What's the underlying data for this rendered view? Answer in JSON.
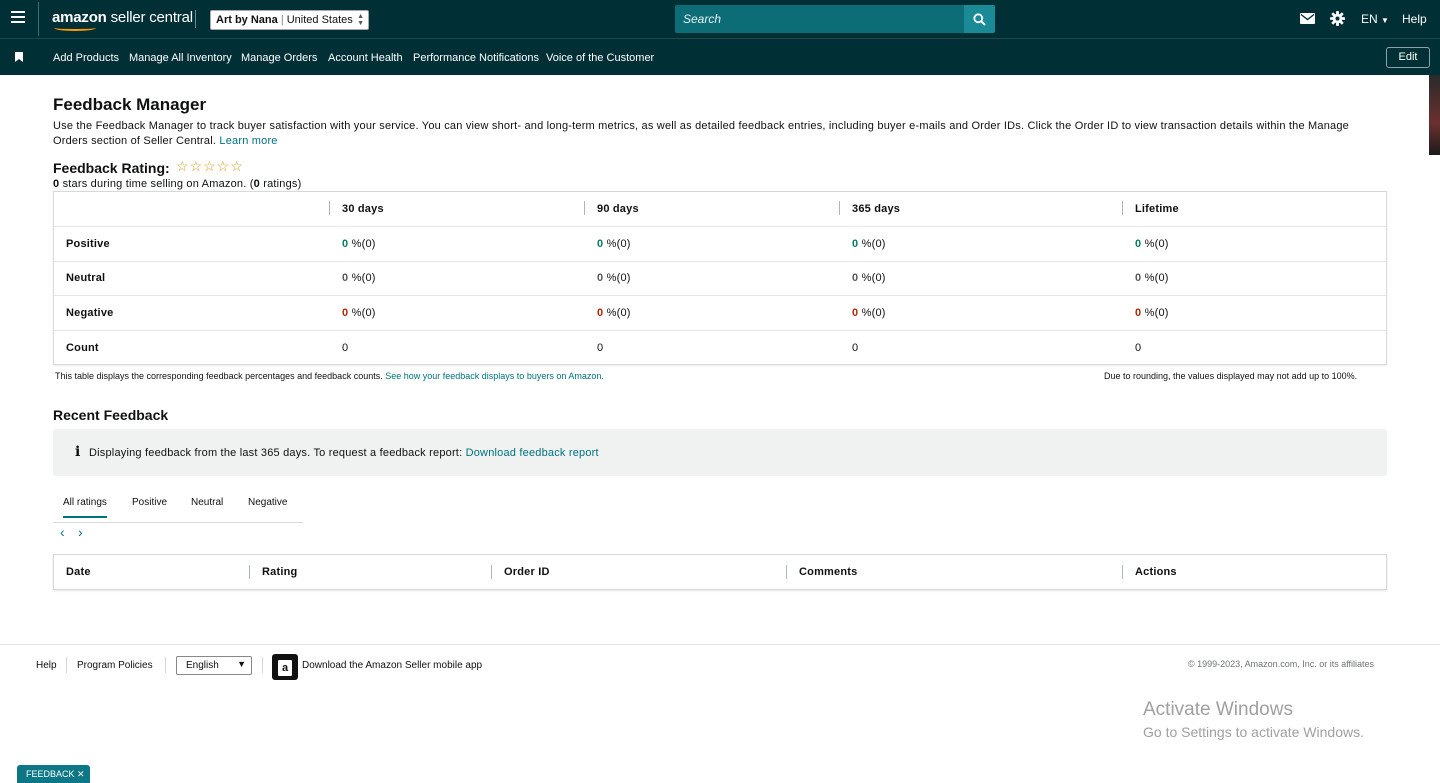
{
  "topbar": {
    "logo_main": "amazon",
    "logo_sub": "seller central",
    "account_store": "Art by Nana",
    "account_region": "United States",
    "search_placeholder": "Search",
    "language": "EN",
    "help": "Help",
    "icons": [
      "menu-icon",
      "mail-icon",
      "gear-icon",
      "search-icon"
    ]
  },
  "navbar": {
    "links": [
      "Add Products",
      "Manage All Inventory",
      "Manage Orders",
      "Account Health",
      "Performance Notifications",
      "Voice of the Customer"
    ],
    "edit": "Edit"
  },
  "main": {
    "title": "Feedback Manager",
    "description": "Use the Feedback Manager to track buyer satisfaction with your service. You can view short- and long-term metrics, as well as detailed feedback entries, including buyer e-mails and Order IDs. Click the Order ID to view transaction details within the Manage Orders section of Seller Central.",
    "learn_more": "Learn more",
    "rating_label": "Feedback Rating:",
    "stars": "☆☆☆☆☆",
    "rating_stars_value": "0",
    "rating_text_mid": "stars during time selling on Amazon. (",
    "rating_count": "0",
    "rating_text_end": "ratings)"
  },
  "feedback_table": {
    "columns": [
      "30 days",
      "90 days",
      "365 days",
      "Lifetime"
    ],
    "rows": [
      {
        "label": "Positive",
        "cells": [
          [
            "0",
            "%(0)"
          ],
          [
            "0",
            "%(0)"
          ],
          [
            "0",
            "%(0)"
          ],
          [
            "0",
            "%(0)"
          ]
        ]
      },
      {
        "label": "Neutral",
        "cells": [
          [
            "0",
            "%(0)"
          ],
          [
            "0",
            "%(0)"
          ],
          [
            "0",
            "%(0)"
          ],
          [
            "0",
            "%(0)"
          ]
        ]
      },
      {
        "label": "Negative",
        "cells": [
          [
            "0",
            "%(0)"
          ],
          [
            "0",
            "%(0)"
          ],
          [
            "0",
            "%(0)"
          ],
          [
            "0",
            "%(0)"
          ]
        ]
      },
      {
        "label": "Count",
        "cells": [
          [
            "0",
            ""
          ],
          [
            "0",
            ""
          ],
          [
            "0",
            ""
          ],
          [
            "0",
            ""
          ]
        ]
      }
    ],
    "note_left": "This table displays the corresponding feedback percentages and feedback counts.",
    "note_left_link": "See how your feedback displays to buyers on Amazon.",
    "note_right": "Due to rounding, the values displayed may not add up to 100%.",
    "colors": {
      "positive": "#067d62",
      "neutral": "#565959",
      "negative": "#b12704"
    }
  },
  "recent": {
    "title": "Recent Feedback",
    "info_icon": "i",
    "info_text": "Displaying feedback from the last 365 days. To request a feedback report:",
    "info_link": "Download feedback report",
    "tabs": [
      "All ratings",
      "Positive",
      "Neutral",
      "Negative"
    ],
    "active_tab": "All ratings",
    "prev": "‹",
    "next": "›",
    "columns": [
      "Date",
      "Rating",
      "Order ID",
      "Comments",
      "Actions"
    ]
  },
  "footer": {
    "help": "Help",
    "program_policies": "Program Policies",
    "language_selected": "English",
    "app_text": "Download the Amazon Seller mobile app",
    "copyright": "© 1999-2023, Amazon.com, Inc. or its affiliates"
  },
  "watermark": {
    "line1": "Activate Windows",
    "line2": "Go to Settings to activate Windows."
  },
  "feedback_tab": "FEEDBACK ✕",
  "accent_color": "#002f36"
}
